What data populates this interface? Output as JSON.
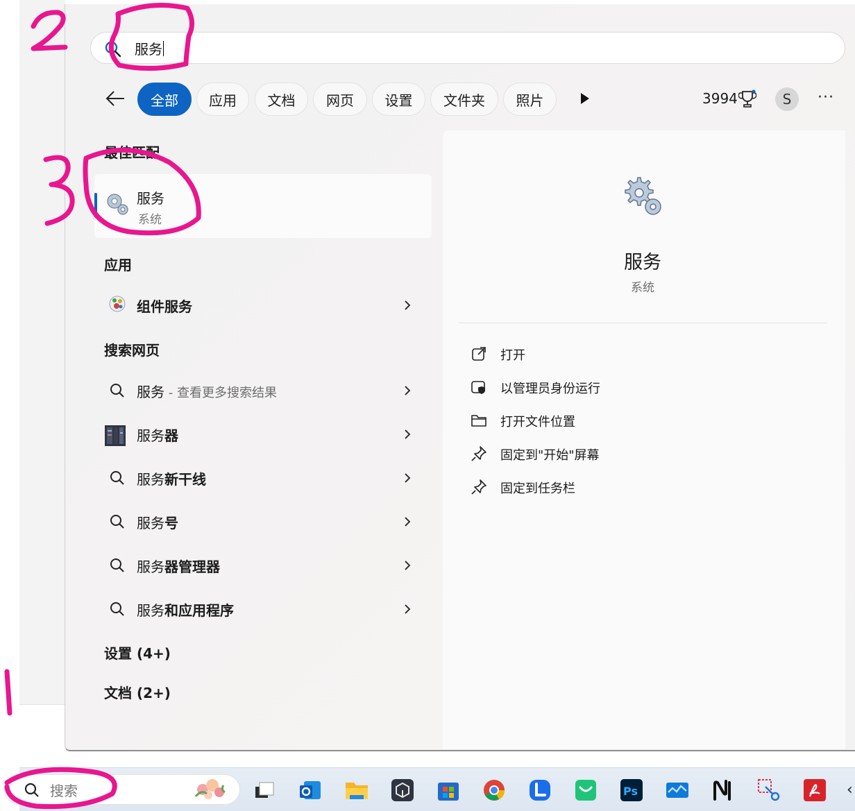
{
  "search": {
    "query": "服务"
  },
  "filters": {
    "tabs": [
      {
        "label": "全部",
        "active": true
      },
      {
        "label": "应用"
      },
      {
        "label": "文档"
      },
      {
        "label": "网页"
      },
      {
        "label": "设置"
      },
      {
        "label": "文件夹"
      },
      {
        "label": "照片"
      }
    ],
    "points": "3994",
    "avatar_initial": "S",
    "menu": "···"
  },
  "best_match": {
    "section_label": "最佳匹配",
    "title": "服务",
    "subtitle": "系统"
  },
  "apps": {
    "section_label": "应用",
    "items": [
      {
        "label": "组件服务"
      }
    ]
  },
  "web": {
    "section_label": "搜索网页",
    "items": [
      {
        "prefix": "服务",
        "hint": " - 查看更多搜索结果",
        "bold": ""
      },
      {
        "prefix": "服务",
        "hint": "",
        "bold": "器"
      },
      {
        "prefix": "服务",
        "hint": "",
        "bold": "新干线"
      },
      {
        "prefix": "服务",
        "hint": "",
        "bold": "号"
      },
      {
        "prefix": "服务",
        "hint": "",
        "bold": "器管理器"
      },
      {
        "prefix": "服务",
        "hint": "",
        "bold": "和应用程序"
      }
    ]
  },
  "more_sections": [
    {
      "label": "设置 (4+)"
    },
    {
      "label": "文档 (2+)"
    }
  ],
  "detail": {
    "title": "服务",
    "subtitle": "系统",
    "actions": [
      {
        "label": "打开",
        "icon": "open-external-icon"
      },
      {
        "label": "以管理员身份运行",
        "icon": "shield-admin-icon"
      },
      {
        "label": "打开文件位置",
        "icon": "folder-icon"
      },
      {
        "label": "固定到\"开始\"屏幕",
        "icon": "pin-icon"
      },
      {
        "label": "固定到任务栏",
        "icon": "pin-icon"
      }
    ]
  },
  "taskbar": {
    "search_placeholder": "搜索",
    "apps": [
      "task-view",
      "outlook",
      "file-explorer",
      "app-cube",
      "microsoft-store",
      "chrome",
      "lenovo",
      "green-app",
      "photoshop",
      "monitor-app",
      "notion-like",
      "snipping-tool",
      "acrobat"
    ]
  },
  "colors": {
    "accent": "#0d64c2",
    "annotation": "#e8168f"
  }
}
